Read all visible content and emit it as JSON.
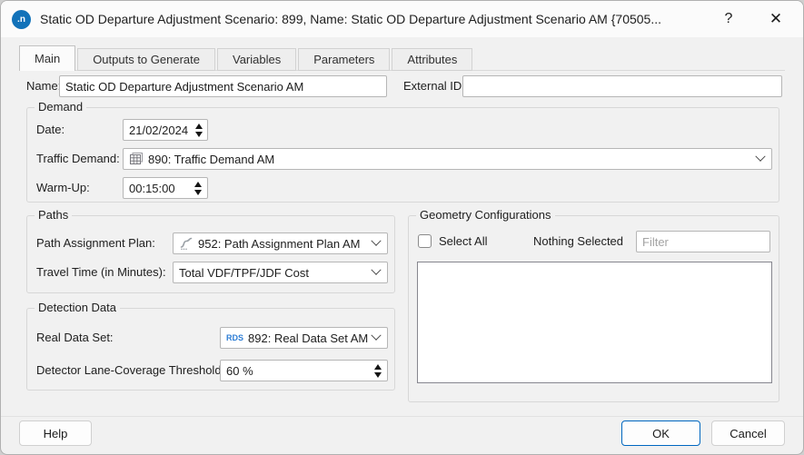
{
  "window": {
    "title": "Static OD Departure Adjustment Scenario: 899, Name: Static OD Departure Adjustment Scenario AM  {70505...",
    "app_icon_text": ".n",
    "help_glyph": "?",
    "close_glyph": "✕"
  },
  "tabs": [
    {
      "label": "Main",
      "active": true
    },
    {
      "label": "Outputs to Generate",
      "active": false
    },
    {
      "label": "Variables",
      "active": false
    },
    {
      "label": "Parameters",
      "active": false
    },
    {
      "label": "Attributes",
      "active": false
    }
  ],
  "form": {
    "name": {
      "label": "Name:",
      "value": "Static OD Departure Adjustment Scenario AM"
    },
    "external_id": {
      "label": "External ID:",
      "value": ""
    },
    "demand": {
      "legend": "Demand",
      "date": {
        "label": "Date:",
        "value": "21/02/2024"
      },
      "traffic_demand": {
        "label": "Traffic Demand:",
        "value": "890: Traffic Demand AM"
      },
      "warm_up": {
        "label": "Warm-Up:",
        "value": "00:15:00"
      }
    },
    "paths": {
      "legend": "Paths",
      "plan": {
        "label": "Path Assignment Plan:",
        "value": "952: Path Assignment Plan AM"
      },
      "travel_time": {
        "label": "Travel Time (in Minutes):",
        "value": "Total VDF/TPF/JDF Cost"
      }
    },
    "detection": {
      "legend": "Detection Data",
      "real_data_set": {
        "label": "Real Data Set:",
        "value": "892: Real Data Set AM",
        "icon_text": "RDS"
      },
      "threshold": {
        "label": "Detector Lane-Coverage Threshold:",
        "value": "60 %"
      }
    },
    "geometry": {
      "legend": "Geometry Configurations",
      "select_all_label": "Select All",
      "status_text": "Nothing Selected",
      "filter_placeholder": "Filter"
    }
  },
  "footer": {
    "help": "Help",
    "ok": "OK",
    "cancel": "Cancel"
  },
  "colors": {
    "accent": "#0067c0",
    "rds_blue": "#2e7ed5",
    "app_icon_bg": "#1272b9"
  }
}
